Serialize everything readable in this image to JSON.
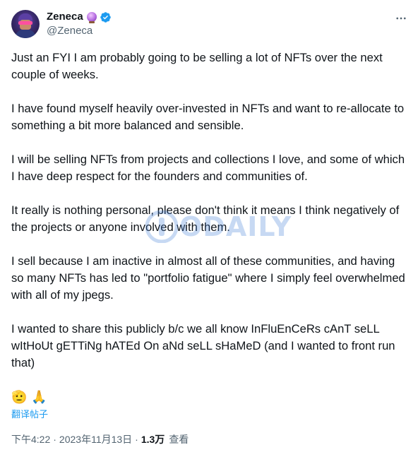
{
  "author": {
    "display_name": "Zeneca",
    "handle": "@Zeneca"
  },
  "tweet": {
    "paragraphs": [
      "Just an FYI I am probably going to be selling a lot of NFTs over the next couple of weeks.",
      "I have found myself heavily over-invested in NFTs and want to re-allocate to something a bit more balanced and sensible.",
      "I will be selling NFTs from projects and collections I love, and some of which I have deep respect for the founders and communities of.",
      "It really is nothing personal, please don't think it means I think negatively of the projects or anyone involved with them.",
      "I sell because I am inactive in almost all of these communities, and having so many NFTs has led to \"portfolio fatigue\" where I simply feel overwhelmed with all of my jpegs.",
      "I wanted to share this publicly b/c we all know InFluEnCeRs cAnT seLL wItHoUt gETTiNg hATEd On aNd seLL sHaMeD (and I wanted to front run that)"
    ],
    "emojis": [
      "🫡",
      "🙏"
    ],
    "translate_label": "翻译帖子",
    "time": "下午4:22",
    "date": "2023年11月13日",
    "views_count": "1.3万",
    "views_label": "查看",
    "separator": "·"
  },
  "watermark": {
    "text": "ODAILY"
  },
  "colors": {
    "text": "#0f1419",
    "secondary": "#536471",
    "accent": "#1d9bf0"
  },
  "icons": {
    "verified": "verified-badge-icon",
    "more": "more-options-icon",
    "orb": "crystal-ball-icon"
  }
}
